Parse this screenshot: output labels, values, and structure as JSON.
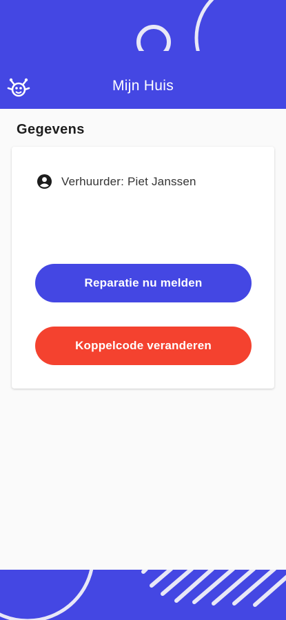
{
  "app": {
    "title": "Mijn Huis",
    "logo_icon": "monster-logo-icon"
  },
  "section": {
    "title": "Gegevens"
  },
  "card": {
    "landlord_icon": "account-circle-icon",
    "landlord_text": "Verhuurder: Piet Janssen",
    "repair_button": "Reparatie nu melden",
    "code_button": "Koppelcode veranderen"
  },
  "colors": {
    "primary": "#4447e3",
    "danger": "#f4422f",
    "background": "#fafafa"
  }
}
